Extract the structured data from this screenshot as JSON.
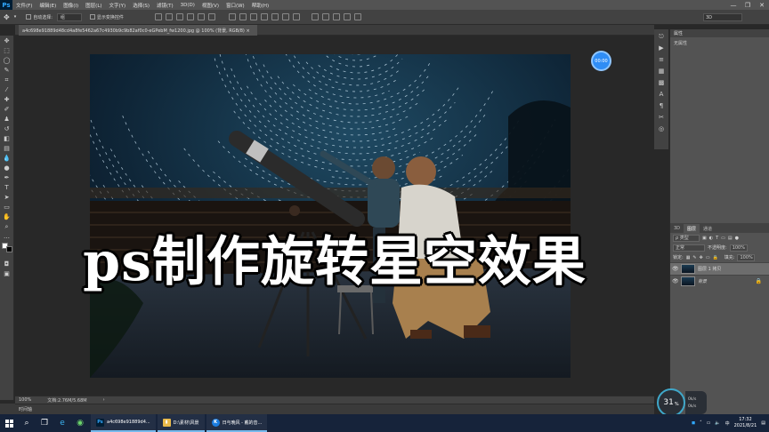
{
  "menubar": {
    "logo": "Ps",
    "items": [
      "文件(F)",
      "编辑(E)",
      "图像(I)",
      "图层(L)",
      "文字(Y)",
      "选择(S)",
      "滤镜(T)",
      "3D(D)",
      "视图(V)",
      "窗口(W)",
      "帮助(H)"
    ],
    "window_controls": [
      "—",
      "❐",
      "✕"
    ]
  },
  "options": {
    "auto_select_label": "自动选择:",
    "auto_select_value": "组",
    "show_transform_label": "显示变换控件",
    "mode_3d": "3D"
  },
  "document": {
    "tab_label": "a4c698e91889d48cd4a8fe5462a67c4930b9c9b82af0c0-eGPebM_fw1200.jpg @ 100% (背景, RGB/8) ×",
    "zoom": "100%",
    "doc_info": "文档:2.76M/5.68M",
    "timeline_label": "时间轴"
  },
  "overlay": {
    "title": "ps制作旋转星空效果",
    "timer": "00:00"
  },
  "panels": {
    "properties_title": "属性",
    "properties_empty": "无属性",
    "layer_tabs": [
      "3D",
      "图层",
      "通道"
    ],
    "kind_label": "ρ 类型",
    "blend_mode": "正常",
    "opacity_label": "不透明度:",
    "opacity_value": "100%",
    "lock_label": "锁定:",
    "fill_label": "填充:",
    "fill_value": "100%",
    "layers": [
      {
        "name": "图层 1 拷贝",
        "selected": true
      },
      {
        "name": "背景",
        "selected": false
      }
    ]
  },
  "system": {
    "speed_percent": "31",
    "speed_unit": "%",
    "up_rate": "0k/s",
    "down_rate": "0k/s",
    "time": "17:32",
    "date": "2021/8/21",
    "taskbar_apps": [
      {
        "label": "a4c698e91889d4...",
        "icon": "Ps",
        "color": "#001d34"
      },
      {
        "label": "D:\\素材\\风景",
        "icon": "▮",
        "color": "#e8b94a"
      },
      {
        "label": "日与晚风 - 戴的音...",
        "icon": "K",
        "color": "#1b7de0"
      }
    ]
  }
}
